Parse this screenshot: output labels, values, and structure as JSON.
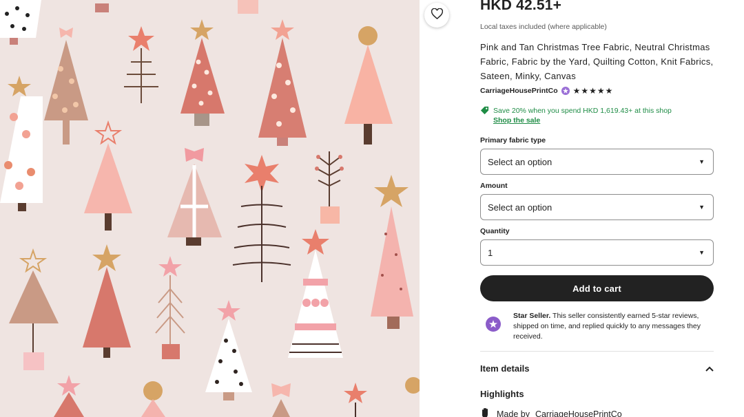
{
  "listing": {
    "price": "HKD 42.51+",
    "tax_note": "Local taxes included (where applicable)",
    "title": "Pink and Tan Christmas Tree Fabric, Neutral Christmas Fabric, Fabric by the Yard, Quilting Cotton, Knit Fabrics, Sateen, Minky, Canvas",
    "shop_name": "CarriageHousePrintCo",
    "rating_stars": "★★★★★",
    "promo_text": "Save 20% when you spend HKD 1,619.43+ at this shop",
    "promo_link": "Shop the sale"
  },
  "options": {
    "fabric_label": "Primary fabric type",
    "fabric_value": "Select an option",
    "amount_label": "Amount",
    "amount_value": "Select an option",
    "quantity_label": "Quantity",
    "quantity_value": "1"
  },
  "actions": {
    "add_to_cart": "Add to cart"
  },
  "star_seller": {
    "bold": "Star Seller.",
    "text": " This seller consistently earned 5-star reviews, shipped on time, and replied quickly to any messages they received."
  },
  "details": {
    "item_details": "Item details",
    "highlights": "Highlights",
    "made_by_prefix": "Made by",
    "made_by_shop": "CarriageHousePrintCo"
  },
  "colors": {
    "image_bg": "#efe4e1",
    "promo_green": "#1e8c45",
    "star_seller_purple": "#8b5cc9",
    "button_dark": "#222222"
  },
  "icons": {
    "favorite": "heart-icon",
    "promo": "tag-icon",
    "seller_badge": "star-seller-badge-icon",
    "collapse": "chevron-up-icon",
    "made_by": "hand-icon"
  }
}
